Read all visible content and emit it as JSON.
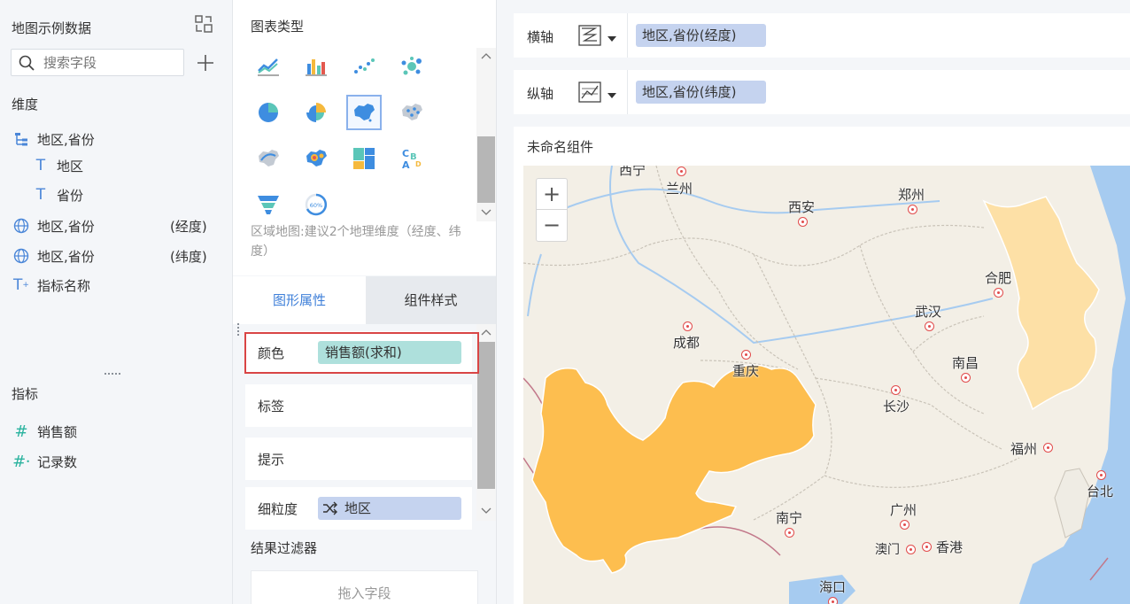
{
  "data_panel": {
    "title": "地图示例数据",
    "search_placeholder": "搜索字段",
    "dimensions_title": "维度",
    "dimensions": [
      {
        "label": "地区,省份",
        "icon": "hierarchy-icon"
      },
      {
        "label": "地区",
        "icon": "text-field-icon"
      },
      {
        "label": "省份",
        "icon": "text-field-icon"
      },
      {
        "label": "地区,省份",
        "suffix": "(经度)",
        "icon": "globe-icon"
      },
      {
        "label": "地区,省份",
        "suffix": "(纬度)",
        "icon": "globe-icon"
      },
      {
        "label": "指标名称",
        "icon": "text-field-icon"
      }
    ],
    "measures_title": "指标",
    "measures": [
      {
        "label": "销售额",
        "icon": "hash-icon"
      },
      {
        "label": "记录数",
        "icon": "hash-star-icon"
      }
    ]
  },
  "chart_type_panel": {
    "title": "图表类型",
    "hint": "区域地图:建议2个地理维度（经度、纬度）",
    "types": [
      "line-chart-icon",
      "bar-chart-icon",
      "scatter-chart-icon",
      "bubble-chart-icon",
      "pie-chart-icon",
      "rose-chart-icon",
      "region-map-icon",
      "point-map-icon",
      "flow-map-icon",
      "heat-map-icon",
      "treemap-icon",
      "word-cloud-icon",
      "funnel-chart-icon",
      "gauge-chart-icon"
    ],
    "selected_index": 6,
    "gauge_text": "60%"
  },
  "tabs": {
    "graphic": "图形属性",
    "component": "组件样式"
  },
  "properties": {
    "color_label": "颜色",
    "color_value": "销售额(求和)",
    "label_label": "标签",
    "tooltip_label": "提示",
    "granularity_label": "细粒度",
    "granularity_value": "地区"
  },
  "filter": {
    "title": "结果过滤器",
    "drop_hint": "拖入字段"
  },
  "axes": {
    "x_label": "横轴",
    "x_value": "地区,省份(经度)",
    "y_label": "纵轴",
    "y_value": "地区,省份(纬度)"
  },
  "widget": {
    "title": "未命名组件"
  },
  "map": {
    "zoom_in": "+",
    "zoom_out": "−",
    "cities": [
      "西宁",
      "兰州",
      "郑州",
      "西安",
      "合肥",
      "武汉",
      "成都",
      "重庆",
      "南昌",
      "长沙",
      "福州",
      "台北",
      "南宁",
      "广州",
      "澳门",
      "香港",
      "海口"
    ]
  },
  "colors": {
    "accent": "#3e7fd9",
    "highlight_border": "#d94545",
    "high_value_region": "#fdbe4f",
    "low_value_region": "#fde0a6",
    "sea": "#a6cbf0"
  }
}
